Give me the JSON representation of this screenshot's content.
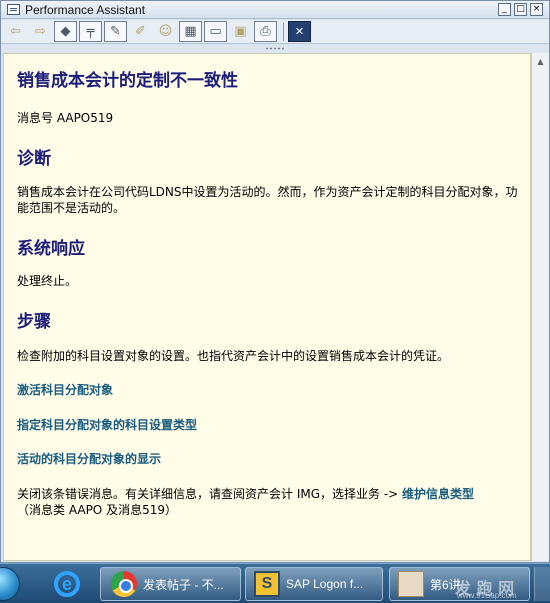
{
  "window": {
    "title": "Performance Assistant",
    "controls": {
      "minimize": "_",
      "maximize": "□",
      "close": "×"
    }
  },
  "toolbar": {
    "buttons": [
      {
        "name": "back-icon",
        "glyph": "⇦"
      },
      {
        "name": "forward-icon",
        "glyph": "⇨"
      },
      {
        "name": "book-icon",
        "glyph": "◆"
      },
      {
        "name": "technical-info-icon",
        "glyph": "╤"
      },
      {
        "name": "edit-icon",
        "glyph": "✎"
      },
      {
        "name": "comment-icon",
        "glyph": "✐"
      },
      {
        "name": "user-icon",
        "glyph": "☺"
      },
      {
        "name": "table-icon",
        "glyph": "▦"
      },
      {
        "name": "settings-icon",
        "glyph": "▭"
      },
      {
        "name": "print-preview-icon",
        "glyph": "▣"
      },
      {
        "name": "print-icon",
        "glyph": "⎙"
      },
      {
        "name": "exit-icon",
        "glyph": "✕"
      }
    ]
  },
  "content": {
    "title": "销售成本会计的定制不一致性",
    "message_number": "消息号  AAPO519",
    "diagnosis_heading": "诊断",
    "diagnosis_text": "销售成本会计在公司代码LDNS中设置为活动的。然而，作为资产会计定制的科目分配对象，功能范围不是活动的。",
    "system_response_heading": "系统响应",
    "system_response_text": "处理终止。",
    "procedure_heading": "步骤",
    "procedure_text": "检查附加的科目设置对象的设置。也指代资产会计中的设置销售成本会计的凭证。",
    "links": [
      "激活科目分配对象",
      "指定科目分配对象的科目设置类型",
      "活动的科目分配对象的显示"
    ],
    "closing_text_prefix": "关闭该条错误消息。有关详细信息，请查阅资产会计  IMG，选择业务  ->",
    "closing_link": "维护信息类型",
    "closing_text_suffix": "（消息类  AAPO 及消息519）"
  },
  "taskbar": {
    "chrome_label": "发表帖子 - 不...",
    "sap_label": "SAP Logon f...",
    "third_label": "第6讲",
    "ie_glyph": "e",
    "sap_glyph": "S"
  },
  "watermark": {
    "text": "发 跑 网",
    "url": "www.91Sap.com"
  }
}
